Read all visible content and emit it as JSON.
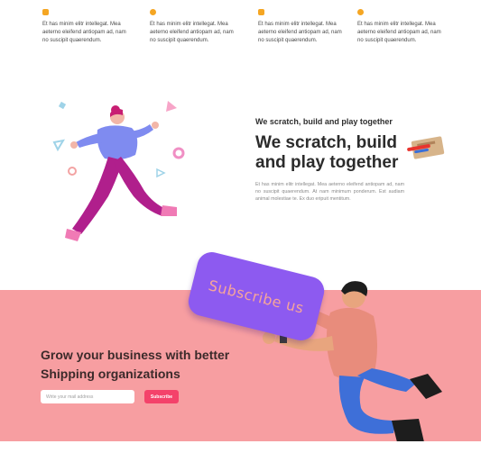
{
  "features": [
    {
      "icon": "square-icon",
      "color": "#f5a623",
      "text": "Et has minim elitr intellegat. Mea aeterno eleifend antiopam ad, nam no suscipit quaerendum."
    },
    {
      "icon": "circle-icon",
      "color": "#f5a623",
      "text": "Et has minim elitr intellegat. Mea aeterno eleifend antiopam ad, nam no suscipit quaerendum."
    },
    {
      "icon": "box-icon",
      "color": "#f5a623",
      "text": "Et has minim elitr intellegat. Mea aeterno eleifend antiopam ad, nam no suscipit quaerendum."
    },
    {
      "icon": "circle-icon",
      "color": "#f5a623",
      "text": "Et has minim elitr intellegat. Mea aeterno eleifend antiopam ad, nam no suscipit quaerendum."
    }
  ],
  "hero": {
    "eyebrow": "We scratch, build and play together",
    "headline": "We scratch, build and play together",
    "paragraph": "Et has minim elitr intellegat. Mea aeterno eleifend antiopam ad, nam no suscipit quaerendum. At nam minimum ponderum. Est audiam animal molestiae te. Ex duo eripuit mentitum."
  },
  "subscribe": {
    "title": "Grow your business with better Shipping organizations",
    "email_placeholder": "Write your mail address",
    "button_label": "Subscribe",
    "sign_text": "Subscribe us",
    "background": "#f79ea1",
    "button_color": "#f4426a",
    "sign_color": "#8d5af0"
  }
}
